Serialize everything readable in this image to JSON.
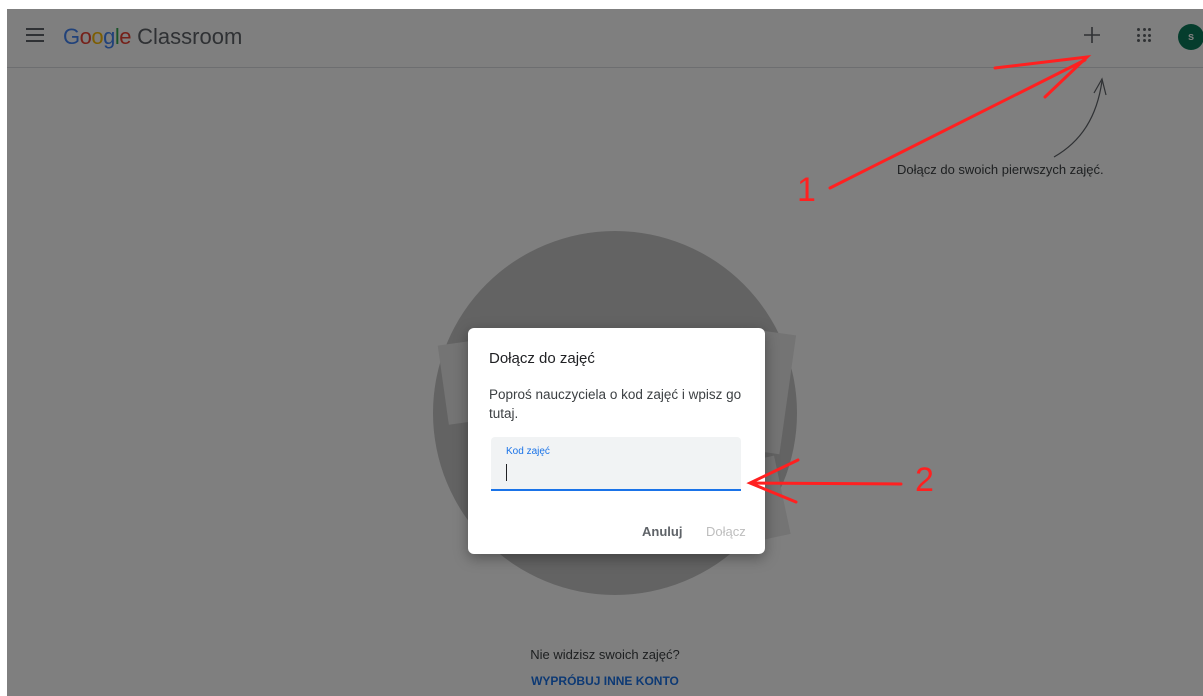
{
  "app": {
    "logo_google": [
      "G",
      "o",
      "o",
      "g",
      "l",
      "e"
    ],
    "logo_product": "Classroom",
    "avatar_initial": "s"
  },
  "hint": {
    "text": "Dołącz do swoich pierwszych zajęć."
  },
  "empty_state": {
    "question": "Nie widzisz swoich zajęć?",
    "action": "WYPRÓBUJ INNE KONTO"
  },
  "dialog": {
    "title": "Dołącz do zajęć",
    "description": "Poproś nauczyciela o kod zajęć i wpisz go tutaj.",
    "field_label": "Kod zajęć",
    "field_value": "",
    "cancel_label": "Anuluj",
    "join_label": "Dołącz"
  },
  "annotations": {
    "label_1": "1",
    "label_2": "2"
  },
  "colors": {
    "google_blue": "#4285f4",
    "google_red": "#ea4335",
    "google_yellow": "#fbbc05",
    "google_green": "#34a853",
    "accent": "#1a73e8",
    "avatar": "#0b7a5a",
    "annotation": "#ff2020"
  },
  "icons": [
    "menu-icon",
    "plus-icon",
    "apps-grid-icon",
    "curved-arrow-icon"
  ]
}
